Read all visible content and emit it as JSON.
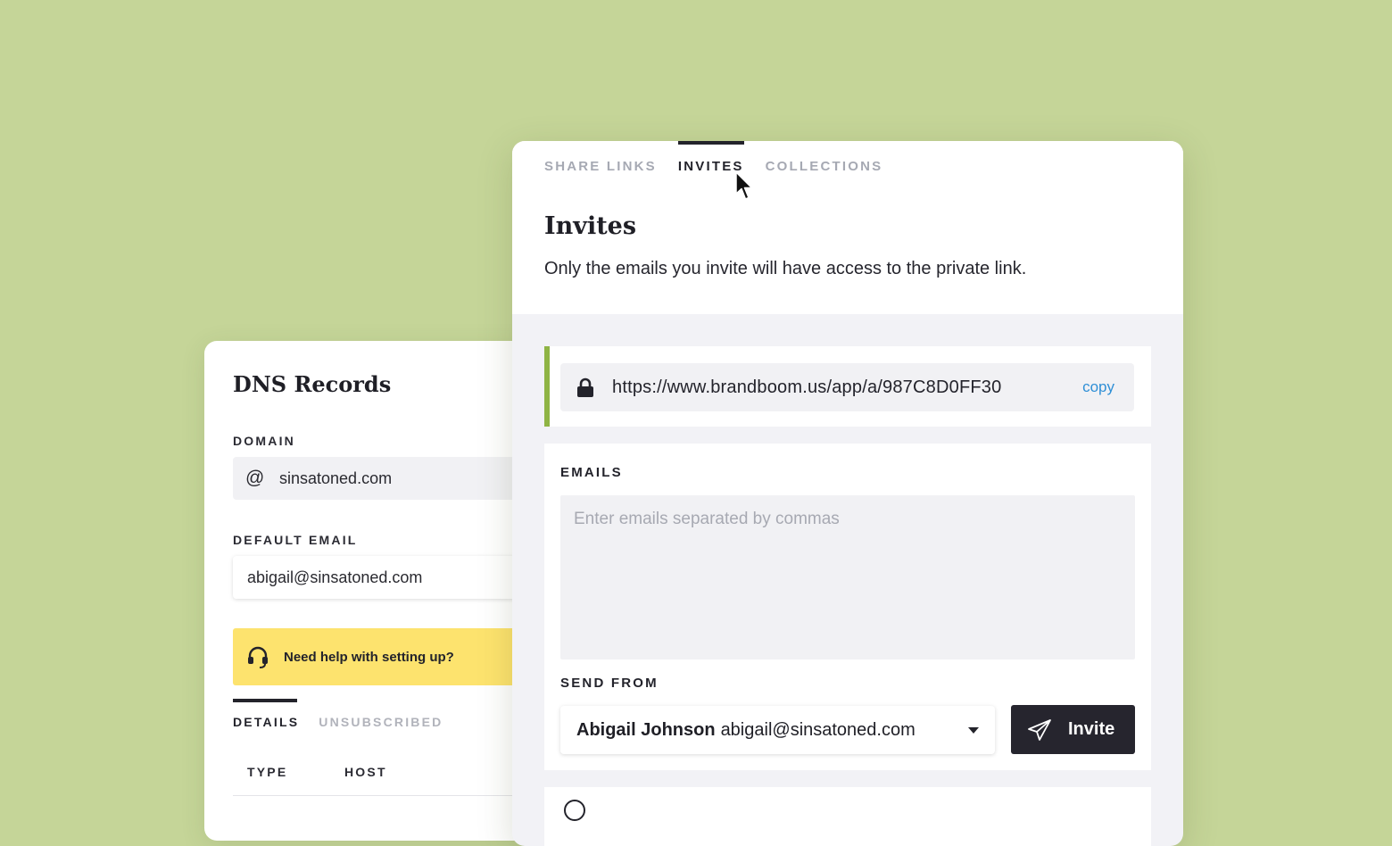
{
  "dns": {
    "title": "DNS Records",
    "domain_label": "DOMAIN",
    "domain_value": "sinsatoned.com",
    "default_email_label": "DEFAULT EMAIL",
    "default_email_value": "abigail@sinsatoned.com",
    "help_text": "Need help with setting up?",
    "tabs": [
      {
        "label": "DETAILS",
        "active": true
      },
      {
        "label": "UNSUBSCRIBED",
        "active": false
      }
    ],
    "columns": [
      "TYPE",
      "HOST"
    ]
  },
  "invites": {
    "tabs": [
      {
        "label": "SHARE LINKS",
        "active": false
      },
      {
        "label": "INVITES",
        "active": true
      },
      {
        "label": "COLLECTIONS",
        "active": false
      }
    ],
    "title": "Invites",
    "description": "Only the emails you invite will have access to the private link.",
    "link_url": "https://www.brandboom.us/app/a/987C8D0FF30",
    "copy_label": "copy",
    "emails_label": "EMAILS",
    "emails_placeholder": "Enter emails separated by commas",
    "send_from_label": "SEND FROM",
    "sender_name": "Abigail Johnson",
    "sender_email": "abigail@sinsatoned.com",
    "invite_button_label": "Invite"
  },
  "icons": {
    "domain": "at-icon",
    "help": "headset-icon",
    "link": "lock-icon",
    "select": "caret-down-icon",
    "invite": "paper-plane-icon",
    "pointer": "mouse-cursor-icon"
  },
  "colors": {
    "background": "#c5d598",
    "accent_green": "#8fb444",
    "help_yellow": "#fde36e",
    "link_blue": "#2f8fd6",
    "dark_button": "#26252e"
  }
}
